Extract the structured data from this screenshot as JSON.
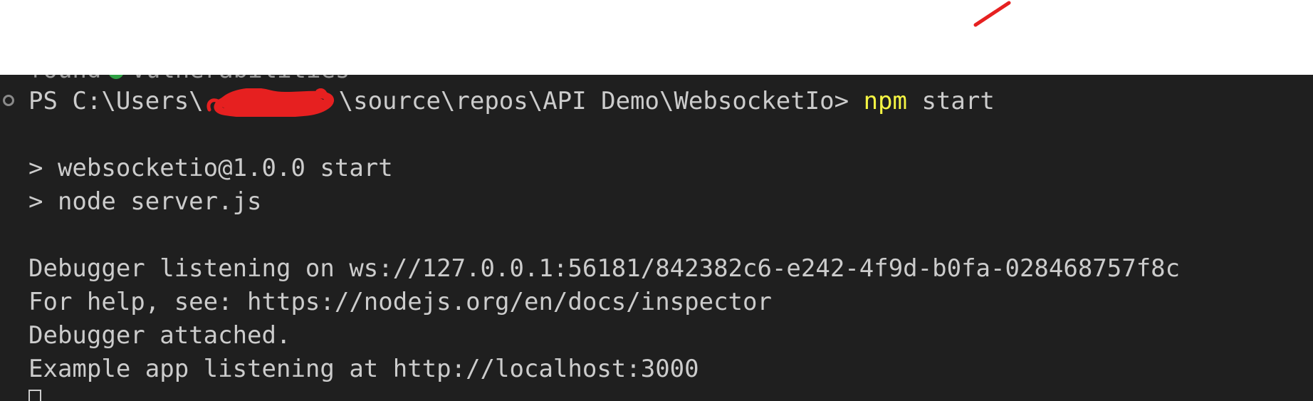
{
  "terminal": {
    "cut_line_start": "found",
    "cut_line_end": "vulnerabilities",
    "prompt_prefix": "PS C:\\Users\\",
    "prompt_suffix": "\\source\\repos\\API Demo\\WebsocketIo> ",
    "command_name": "npm",
    "command_args": " start",
    "output_lines": [
      "> websocketio@1.0.0 start",
      "> node server.js",
      "Debugger listening on ws://127.0.0.1:56181/842382c6-e242-4f9d-b0fa-028468757f8c",
      "For help, see: https://nodejs.org/en/docs/inspector",
      "Debugger attached.",
      "Example app listening at http://localhost:3000"
    ]
  },
  "colors": {
    "terminal_bg": "#1f1f1f",
    "text": "#cccccc",
    "command": "#f5f543",
    "success_dot": "#2ea043",
    "annotation_red": "#e62020"
  }
}
